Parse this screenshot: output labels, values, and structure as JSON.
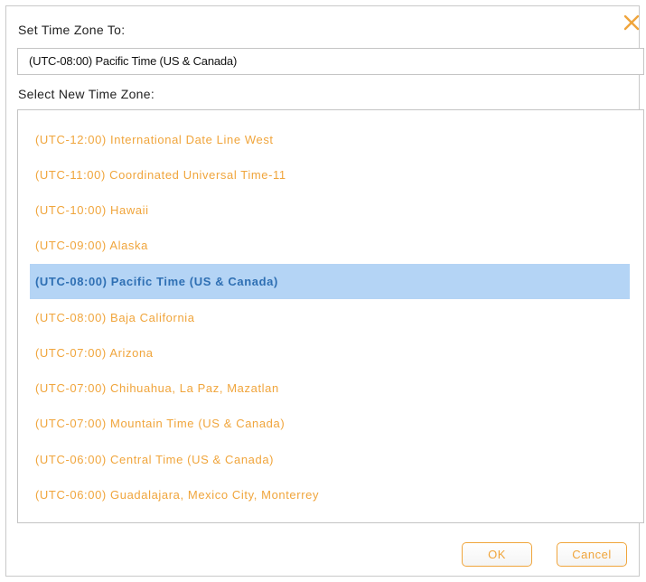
{
  "dialog": {
    "current_label": "Set Time Zone To:",
    "current_value": "(UTC-08:00) Pacific Time (US & Canada)",
    "new_label": "Select New Time Zone:",
    "close_icon": "close-x-icon",
    "ok_label": "OK",
    "cancel_label": "Cancel"
  },
  "timezones": [
    {
      "label": "(UTC-12:00) International Date Line West"
    },
    {
      "label": "(UTC-11:00) Coordinated Universal Time-11"
    },
    {
      "label": "(UTC-10:00) Hawaii"
    },
    {
      "label": "(UTC-09:00) Alaska"
    },
    {
      "label": "(UTC-08:00) Pacific Time (US & Canada)"
    },
    {
      "label": "(UTC-08:00) Baja California"
    },
    {
      "label": "(UTC-07:00) Arizona"
    },
    {
      "label": "(UTC-07:00) Chihuahua, La Paz, Mazatlan"
    },
    {
      "label": "(UTC-07:00) Mountain Time (US & Canada)"
    },
    {
      "label": "(UTC-06:00) Central Time (US & Canada)"
    },
    {
      "label": "(UTC-06:00) Guadalajara, Mexico City, Monterrey"
    }
  ],
  "selected_index": 4,
  "colors": {
    "accent": "#f0a53c",
    "selected_bg": "#b4d4f5",
    "selected_text": "#2e6fb3"
  }
}
